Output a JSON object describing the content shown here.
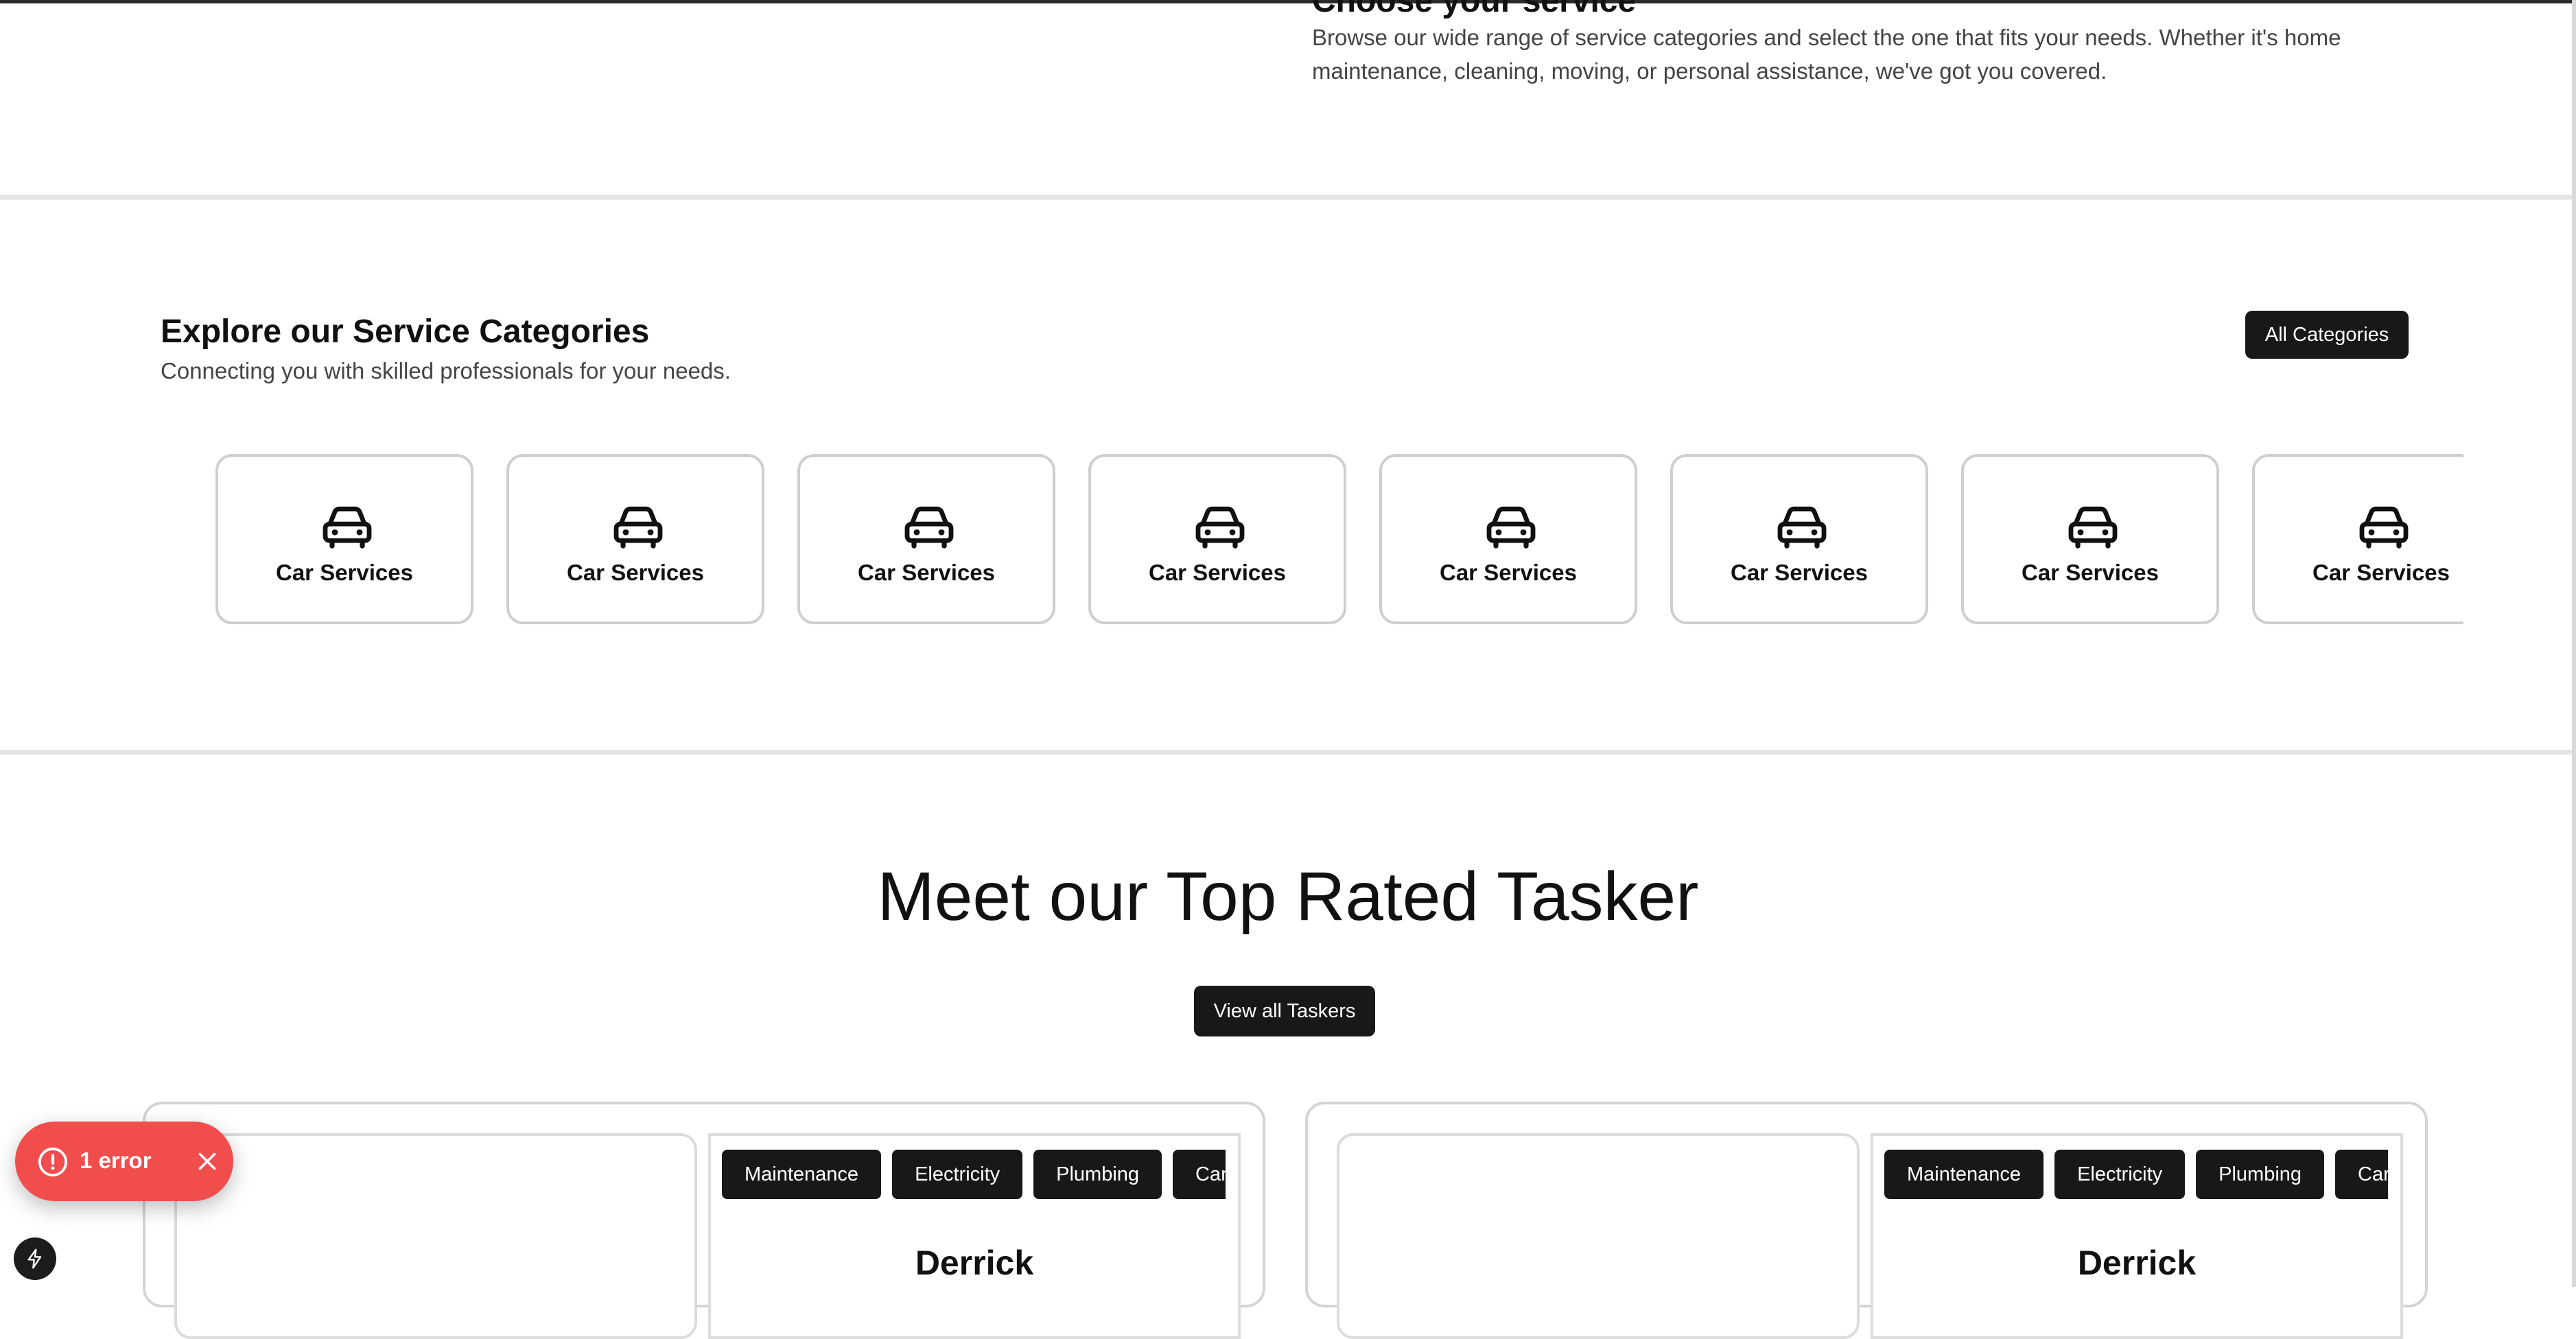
{
  "intro": {
    "title": "Choose your service",
    "description": "Browse our wide range of service categories and select the one that fits your needs. Whether it's home maintenance, cleaning, moving, or personal assistance, we've got you covered."
  },
  "categories": {
    "title": "Explore our Service Categories",
    "subtitle": "Connecting you with skilled professionals for your needs.",
    "all_button": "All Categories",
    "items": [
      {
        "label": "Car Services",
        "icon": "car-icon"
      },
      {
        "label": "Car Services",
        "icon": "car-icon"
      },
      {
        "label": "Car Services",
        "icon": "car-icon"
      },
      {
        "label": "Car Services",
        "icon": "car-icon"
      },
      {
        "label": "Car Services",
        "icon": "car-icon"
      },
      {
        "label": "Car Services",
        "icon": "car-icon"
      },
      {
        "label": "Car Services",
        "icon": "car-icon"
      },
      {
        "label": "Car Services",
        "icon": "car-icon"
      }
    ]
  },
  "taskers": {
    "title": "Meet our Top Rated Tasker",
    "view_all_button": "View all Taskers",
    "cards": [
      {
        "name": "Derrick",
        "tags": [
          "Maintenance",
          "Electricity",
          "Plumbing",
          "Carpentry"
        ]
      },
      {
        "name": "Derrick",
        "tags": [
          "Maintenance",
          "Electricity",
          "Plumbing",
          "Carpentry"
        ]
      }
    ]
  },
  "error_toast": {
    "label": "1 error",
    "icon": "alert-circle-icon",
    "close_icon": "close-icon"
  },
  "badge": {
    "icon": "lightning-bolt-icon"
  },
  "colors": {
    "dark_button": "#18181b",
    "card_border": "#cfcfcf",
    "error_red": "#f14d4d"
  }
}
